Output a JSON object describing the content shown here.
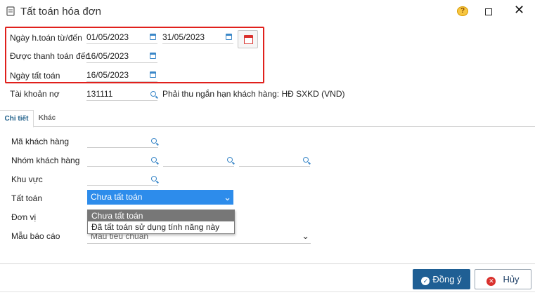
{
  "window": {
    "title": "Tất toán hóa đơn"
  },
  "filters": {
    "date_range_label": "Ngày h.toán từ/đến",
    "date_from": "01/05/2023",
    "date_to": "31/05/2023",
    "paid_to_label": "Được thanh toán đến",
    "paid_to": "16/05/2023",
    "settle_date_label": "Ngày tất toán",
    "settle_date": "16/05/2023"
  },
  "account": {
    "label": "Tài khoản nợ",
    "value": "131111",
    "description": "Phải thu ngắn hạn khách hàng: HĐ SXKD (VND)"
  },
  "tabs": [
    {
      "label": "Chi tiết",
      "active": true
    },
    {
      "label": "Khác",
      "active": false
    }
  ],
  "details": {
    "customer_code_label": "Mã khách hàng",
    "customer_group_label": "Nhóm khách hàng",
    "region_label": "Khu vực",
    "settlement_label": "Tất toán",
    "settlement_value": "Chưa tất toán",
    "unit_label": "Đơn vị",
    "report_template_label": "Mẫu báo cáo",
    "report_template_value": "Mẫu tiêu chuẩn"
  },
  "settlement_options": [
    "Chưa tất toán",
    "Đã tất toán sử dụng tính năng này"
  ],
  "buttons": {
    "ok": "Đồng ý",
    "cancel": "Hủy"
  },
  "colors": {
    "accent": "#1f5f94",
    "selected": "#2d8ceb",
    "highlight": "#e0201c"
  },
  "icons": [
    "app-icon",
    "help-icon",
    "maximize-icon",
    "close-icon",
    "calendar-icon",
    "search-icon",
    "chevron-down-icon",
    "check-icon",
    "x-icon"
  ]
}
